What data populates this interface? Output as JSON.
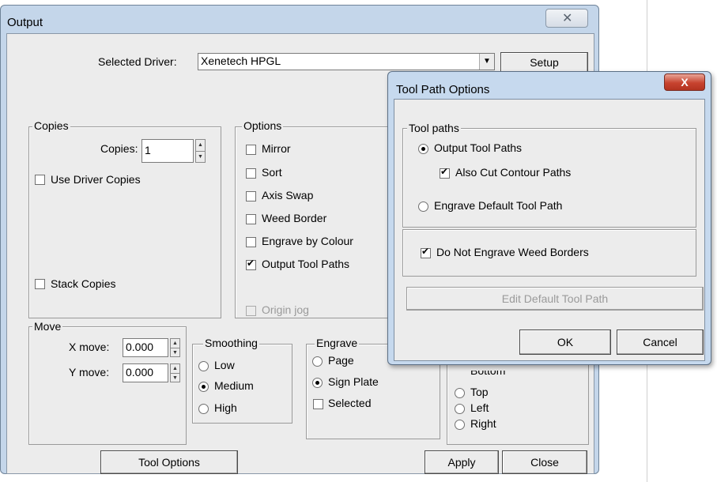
{
  "output": {
    "title": "Output",
    "selected_driver_label": "Selected Driver:",
    "selected_driver_value": "Xenetech HPGL",
    "setup_button": "Setup",
    "copies": {
      "group_label": "Copies",
      "copies_label": "Copies:",
      "copies_value": "1",
      "use_driver_copies": "Use Driver Copies",
      "stack_copies": "Stack Copies"
    },
    "options": {
      "group_label": "Options",
      "items": [
        {
          "label": "Mirror",
          "checked": false
        },
        {
          "label": "Sort",
          "checked": false
        },
        {
          "label": "Axis Swap",
          "checked": false
        },
        {
          "label": "Weed Border",
          "checked": false
        },
        {
          "label": "Engrave by Colour",
          "checked": false
        },
        {
          "label": "Output Tool Paths",
          "checked": true
        }
      ],
      "origin_jog": "Origin jog"
    },
    "move": {
      "group_label": "Move",
      "x_label": "X move:",
      "x_value": "0.000",
      "y_label": "Y move:",
      "y_value": "0.000"
    },
    "smoothing": {
      "group_label": "Smoothing",
      "options": [
        "Low",
        "Medium",
        "High"
      ],
      "selected": "Medium"
    },
    "engrave": {
      "group_label": "Engrave",
      "options": [
        "Page",
        "Sign Plate"
      ],
      "selected": "Sign Plate",
      "selected_checkbox": "Selected"
    },
    "position": {
      "partial_label": "Bottom",
      "options": [
        "Top",
        "Left",
        "Right"
      ]
    },
    "tool_options_button": "Tool Options",
    "apply_button": "Apply",
    "close_button": "Close"
  },
  "tool_path_dialog": {
    "title": "Tool Path Options",
    "close_glyph": "X",
    "tool_paths_group": "Tool paths",
    "output_tool_paths": "Output Tool Paths",
    "also_cut_contour": "Also Cut Contour Paths",
    "engrave_default": "Engrave Default Tool Path",
    "do_not_engrave_weed": "Do Not Engrave Weed Borders",
    "edit_default_button": "Edit Default Tool Path",
    "ok_button": "OK",
    "cancel_button": "Cancel"
  },
  "icons": {
    "window_close": "close-icon",
    "checkmark": "check-icon",
    "dropdown": "chevron-down-icon"
  }
}
